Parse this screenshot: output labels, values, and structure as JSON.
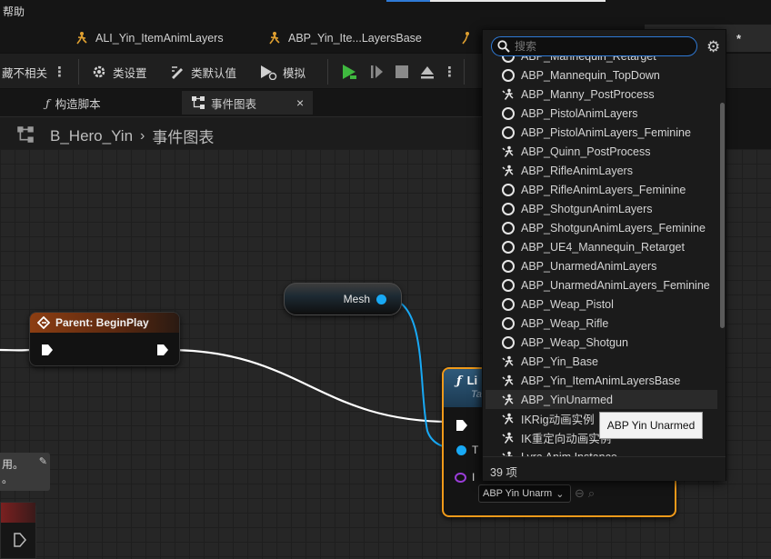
{
  "menubar": {
    "help": "帮助"
  },
  "asset_tabs": [
    {
      "label": "ALI_Yin_ItemAnimLayers"
    },
    {
      "label": "ABP_Yin_Ite...LayersBase"
    }
  ],
  "side_tab_fragment": "*",
  "toolbar": {
    "hide_unrelated": "藏不相关",
    "class_settings": "类设置",
    "class_defaults": "类默认值",
    "simulation": "模拟"
  },
  "doc_tabs": [
    {
      "label": "构造脚本"
    },
    {
      "label": "事件图表"
    }
  ],
  "breadcrumb": {
    "root": "B_Hero_Yin",
    "current": "事件图表"
  },
  "nodes": {
    "mesh_label": "Mesh",
    "begin_play_title": "Parent: BeginPlay",
    "link_title": "Li",
    "link_subtitle": "Ta",
    "link_pin_target": "T",
    "link_pin_instance": "I",
    "link_combo_value": "ABP Yin Unarm",
    "comment_text": "用。\n。"
  },
  "picker": {
    "search_placeholder": "搜索",
    "items": [
      {
        "label": "ABP_Mannequin_Retarget",
        "icon": "circle"
      },
      {
        "label": "ABP_Mannequin_TopDown",
        "icon": "circle"
      },
      {
        "label": "ABP_Manny_PostProcess",
        "icon": "figure"
      },
      {
        "label": "ABP_PistolAnimLayers",
        "icon": "circle"
      },
      {
        "label": "ABP_PistolAnimLayers_Feminine",
        "icon": "circle"
      },
      {
        "label": "ABP_Quinn_PostProcess",
        "icon": "figure"
      },
      {
        "label": "ABP_RifleAnimLayers",
        "icon": "figure"
      },
      {
        "label": "ABP_RifleAnimLayers_Feminine",
        "icon": "circle"
      },
      {
        "label": "ABP_ShotgunAnimLayers",
        "icon": "circle"
      },
      {
        "label": "ABP_ShotgunAnimLayers_Feminine",
        "icon": "circle"
      },
      {
        "label": "ABP_UE4_Mannequin_Retarget",
        "icon": "circle"
      },
      {
        "label": "ABP_UnarmedAnimLayers",
        "icon": "circle"
      },
      {
        "label": "ABP_UnarmedAnimLayers_Feminine",
        "icon": "circle"
      },
      {
        "label": "ABP_Weap_Pistol",
        "icon": "circle"
      },
      {
        "label": "ABP_Weap_Rifle",
        "icon": "circle"
      },
      {
        "label": "ABP_Weap_Shotgun",
        "icon": "circle"
      },
      {
        "label": "ABP_Yin_Base",
        "icon": "figure"
      },
      {
        "label": "ABP_Yin_ItemAnimLayersBase",
        "icon": "figure"
      },
      {
        "label": "ABP_YinUnarmed",
        "icon": "figure",
        "selected": true
      },
      {
        "label": "IKRig动画实例",
        "icon": "figure"
      },
      {
        "label": "IK重定向动画实例",
        "icon": "figure"
      },
      {
        "label": "Lyra Anim Instance",
        "icon": "figure"
      }
    ],
    "count": "39 项"
  },
  "tooltip": "ABP Yin Unarmed",
  "colors": {
    "accent_blue": "#2f7ad6",
    "exec_white": "#ffffff",
    "object_pin": "#18a9f5",
    "selection_orange": "#f09a1a",
    "class_pin": "#9a3dd8",
    "event_header": "#8c3e12"
  }
}
